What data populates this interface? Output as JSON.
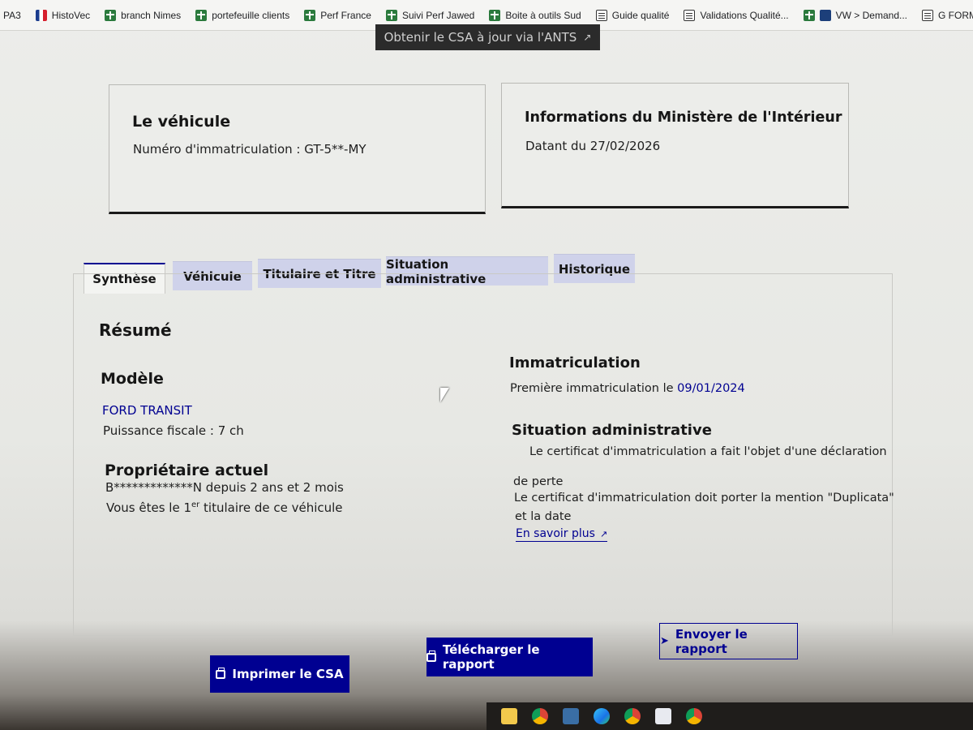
{
  "bookmarks": [
    {
      "label": "PA3",
      "icon": "none"
    },
    {
      "label": "HistoVec",
      "icon": "flag-icon"
    },
    {
      "label": "branch Nimes",
      "icon": "sheet-plus-icon"
    },
    {
      "label": "portefeuille clients",
      "icon": "sheet-plus-icon"
    },
    {
      "label": "Perf France",
      "icon": "sheet-plus-icon"
    },
    {
      "label": "Suivi Perf Jawed",
      "icon": "sheet-plus-icon"
    },
    {
      "label": "Boite à outils Sud",
      "icon": "sheet-plus-icon"
    },
    {
      "label": "Guide qualité",
      "icon": "doc-icon"
    },
    {
      "label": "Validations Qualité...",
      "icon": "doc-icon"
    },
    {
      "label": "VW > Demand...",
      "icon": "sheet-plus-icon"
    },
    {
      "label": "G FORM Contrats à...",
      "icon": "doc-icon"
    }
  ],
  "top_button": {
    "label": "Obtenir le CSA à jour via l'ANTS"
  },
  "vehicle_card": {
    "title": "Le véhicule",
    "plate_text": "Numéro d'immatriculation : GT-5**-MY"
  },
  "ministry_card": {
    "title": "Informations du Ministère de l'Intérieur",
    "date_text": "Datant du 27/02/2026"
  },
  "tabs": [
    "Synthèse",
    "Véhicule",
    "Titulaire et Titre",
    "Situation administrative",
    "Historique"
  ],
  "active_tab": "Synthèse",
  "summary": {
    "heading": "Résumé",
    "model_heading": "Modèle",
    "model_value": "FORD TRANSIT",
    "fiscal_power": "Puissance fiscale : 7 ch",
    "owner_heading": "Propriétaire actuel",
    "owner_line": "B*************N depuis 2 ans et 2 mois",
    "owner_first_a": "Vous êtes le 1",
    "owner_first_sup": "er",
    "owner_first_b": " titulaire de ce véhicule",
    "registration_heading": "Immatriculation",
    "first_registration_prefix": "Première immatriculation le ",
    "first_registration_date": "09/01/2024",
    "admin_heading": "Situation administrative",
    "admin_line1": "Le certificat d'immatriculation a fait l'objet d'une déclaration",
    "admin_line2": "de perte",
    "admin_line3": "Le certificat d'immatriculation doit porter la mention \"Duplicata\"",
    "admin_line4": "et la date",
    "learn_more": "En savoir plus"
  },
  "actions": {
    "print": "Imprimer le CSA",
    "download": "Télécharger le rapport",
    "send": "Envoyer le rapport"
  },
  "colors": {
    "primary": "#000091",
    "tab_inactive": "#cfd2ea",
    "dark_button": "#2b2b2b"
  }
}
